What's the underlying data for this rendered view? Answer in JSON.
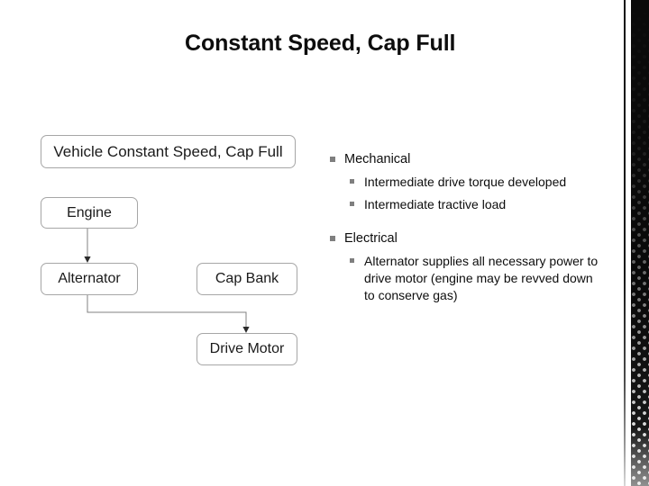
{
  "slide": {
    "title": "Constant Speed, Cap Full",
    "background_color": "#ffffff",
    "title_color": "#0d0d0d"
  },
  "diagram": {
    "node_border_color": "#a6a6a6",
    "connector_color": "#808080",
    "nodes": [
      {
        "id": "vehicle",
        "label": "Vehicle Constant Speed, Cap Full"
      },
      {
        "id": "engine",
        "label": "Engine"
      },
      {
        "id": "alternator",
        "label": "Alternator"
      },
      {
        "id": "capbank",
        "label": "Cap Bank"
      },
      {
        "id": "drivemotor",
        "label": "Drive Motor"
      }
    ],
    "connectors": [
      {
        "from": "engine",
        "to": "alternator"
      },
      {
        "from": "alternator",
        "to": "drivemotor"
      }
    ]
  },
  "bullets": {
    "bullet_color": "#7f7f7f",
    "groups": [
      {
        "heading": "Mechanical",
        "items": [
          "Intermediate drive torque developed",
          "Intermediate tractive load"
        ]
      },
      {
        "heading": "Electrical",
        "items": [
          "Alternator supplies all necessary power to drive motor (engine may be revved down to conserve gas)"
        ]
      }
    ]
  },
  "decoration": {
    "edge_rule_color": "#111111",
    "edge_band_color": "#0b0b0b"
  }
}
